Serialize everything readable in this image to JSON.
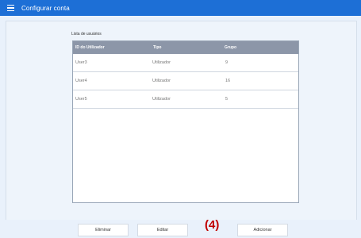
{
  "window": {
    "title": "Configurar conta"
  },
  "list": {
    "label": "Lista de usuários",
    "columns": [
      "ID do Utilizador",
      "Tipo",
      "Grupo"
    ],
    "rows": [
      {
        "id": "User3",
        "type": "Utilizador",
        "group": "9"
      },
      {
        "id": "User4",
        "type": "Utilizador",
        "group": "16"
      },
      {
        "id": "User5",
        "type": "Utilizador",
        "group": "5"
      }
    ]
  },
  "buttons": {
    "delete": "Eliminar",
    "edit": "Editar",
    "add": "Adicionar"
  },
  "annotation": "(4)",
  "icons": {
    "menu": "hamburger-menu-icon"
  },
  "colors": {
    "titlebar": "#1d6fd6",
    "header": "#8c96a8",
    "annotation": "#c00000"
  }
}
